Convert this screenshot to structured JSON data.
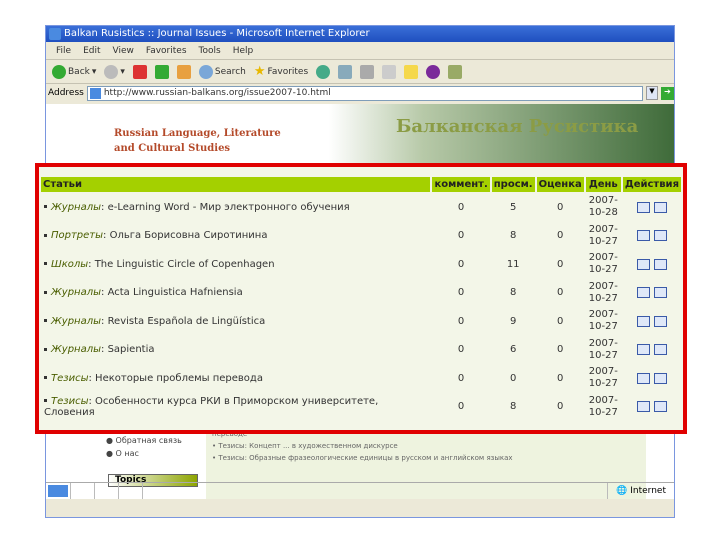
{
  "window": {
    "title": "Balkan Rusistics :: Journal Issues - Microsoft Internet Explorer"
  },
  "menu": [
    "File",
    "Edit",
    "View",
    "Favorites",
    "Tools",
    "Help"
  ],
  "toolbar": {
    "back": "Back",
    "search": "Search",
    "favorites": "Favorites"
  },
  "address": {
    "label": "Address",
    "url": "http://www.russian-balkans.org/issue2007-10.html"
  },
  "banner": {
    "en_line1": "Russian Language, Literature",
    "en_line2": "and Cultural Studies",
    "ru": "Балканская Русистика"
  },
  "leftnav": {
    "items": [
      "Обратная связь",
      "О нас"
    ],
    "topics": "Topics"
  },
  "bg_rows": [
    "переводе",
    "• Тезисы: Концепт ... в художественном дискурсе",
    "• Тезисы: Образные фразеологические единицы в русском и английском языках"
  ],
  "status": {
    "zone": "Internet"
  },
  "table": {
    "headers": [
      "Статьи",
      "коммент.",
      "просм.",
      "Оценка",
      "День",
      "Действия"
    ],
    "rows": [
      {
        "category": "Журналы",
        "title": "e-Learning Word - Мир электронного обучения",
        "comments": "0",
        "views": "5",
        "rating": "0",
        "date1": "2007-",
        "date2": "10-28"
      },
      {
        "category": "Портреты",
        "title": "Ольга Борисовна Сиротинина",
        "comments": "0",
        "views": "8",
        "rating": "0",
        "date1": "2007-",
        "date2": "10-27"
      },
      {
        "category": "Школы",
        "title": "The Linguistic Circle of Copenhagen",
        "comments": "0",
        "views": "11",
        "rating": "0",
        "date1": "2007-",
        "date2": "10-27"
      },
      {
        "category": "Журналы",
        "title": "Acta Linguistica Hafniensia",
        "comments": "0",
        "views": "8",
        "rating": "0",
        "date1": "2007-",
        "date2": "10-27"
      },
      {
        "category": "Журналы",
        "title": "Revista Española de Lingüística",
        "comments": "0",
        "views": "9",
        "rating": "0",
        "date1": "2007-",
        "date2": "10-27"
      },
      {
        "category": "Журналы",
        "title": "Sapientia",
        "comments": "0",
        "views": "6",
        "rating": "0",
        "date1": "2007-",
        "date2": "10-27"
      },
      {
        "category": "Тезисы",
        "title": "Некоторые проблемы перевода",
        "comments": "0",
        "views": "0",
        "rating": "0",
        "date1": "2007-",
        "date2": "10-27"
      },
      {
        "category": "Тезисы",
        "title": "Особенности курса РКИ в Приморском университете, Словения",
        "comments": "0",
        "views": "8",
        "rating": "0",
        "date1": "2007-",
        "date2": "10-27"
      }
    ]
  }
}
